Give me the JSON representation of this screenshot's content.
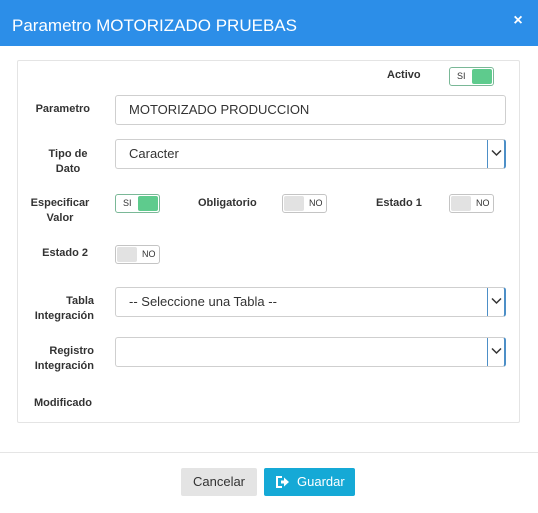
{
  "window": {
    "title": "Parametro MOTORIZADO PRUEBAS",
    "close_glyph": "×"
  },
  "colors": {
    "header": "#2c8ee8",
    "toggle_on": "#5ecb8d",
    "save_button": "#15a9d6"
  },
  "form": {
    "activo": {
      "label": "Activo",
      "toggle": "SI",
      "state": "on"
    },
    "parametro": {
      "label": "Parametro",
      "value": "MOTORIZADO PRODUCCION"
    },
    "tipo_dato": {
      "label_line1": "Tipo de",
      "label_line2": "Dato",
      "selected": "Caracter"
    },
    "especificar_valor": {
      "label_line1": "Especificar",
      "label_line2": "Valor",
      "toggle": "SI",
      "state": "on"
    },
    "obligatorio": {
      "label": "Obligatorio",
      "toggle": "NO",
      "state": "off"
    },
    "estado1": {
      "label": "Estado 1",
      "toggle": "NO",
      "state": "off"
    },
    "estado2": {
      "label": "Estado 2",
      "toggle": "NO",
      "state": "off"
    },
    "tabla_integracion": {
      "label_line1": "Tabla",
      "label_line2": "Integración",
      "selected": "-- Seleccione una Tabla --"
    },
    "registro_integracion": {
      "label_line1": "Registro",
      "label_line2": "Integración",
      "selected": ""
    },
    "modificado": {
      "label": "Modificado"
    }
  },
  "footer": {
    "cancel_label": "Cancelar",
    "save_label": "Guardar",
    "save_icon": "save-icon"
  }
}
